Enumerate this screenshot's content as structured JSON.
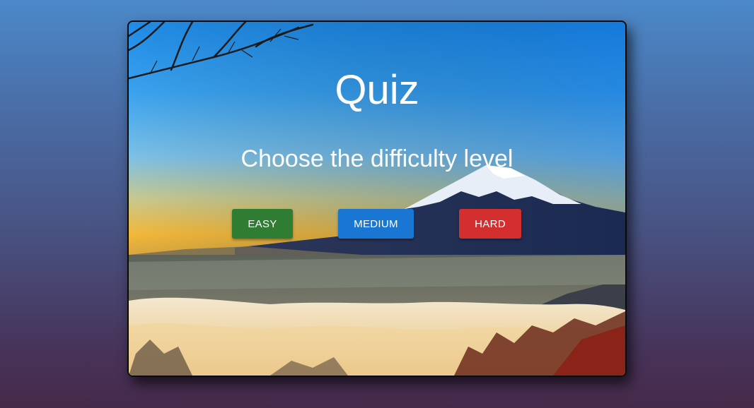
{
  "quiz": {
    "title": "Quiz",
    "prompt": "Choose the difficulty level",
    "buttons": {
      "easy": "EASY",
      "medium": "MEDIUM",
      "hard": "HARD"
    }
  },
  "colors": {
    "easy": "#2e7d32",
    "medium": "#1976d2",
    "hard": "#d32f2f"
  },
  "background_image": "mount-fuji-sunrise-over-clouds"
}
